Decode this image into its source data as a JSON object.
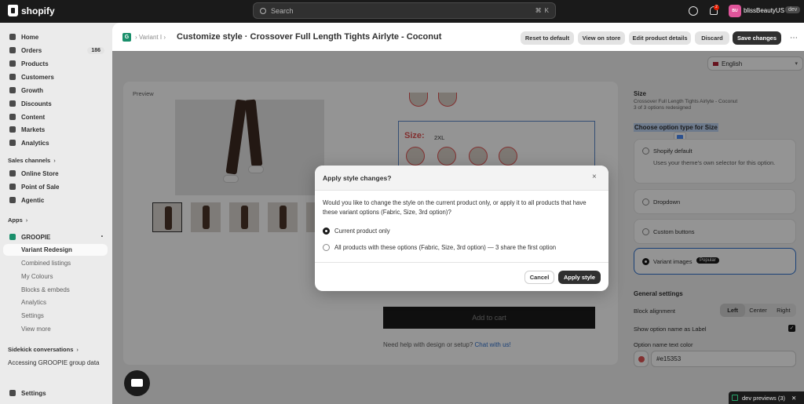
{
  "topbar": {
    "brand": "shopify",
    "search_placeholder": "Search",
    "shortcut_1": "⌘",
    "shortcut_2": "K",
    "notification_count": "2",
    "avatar_initials": "BU",
    "store_name": "blissBeautyUS",
    "dev_badge": "dev"
  },
  "sidebar": {
    "items": [
      {
        "label": "Home"
      },
      {
        "label": "Orders",
        "count": "186"
      },
      {
        "label": "Products"
      },
      {
        "label": "Customers"
      },
      {
        "label": "Growth"
      },
      {
        "label": "Discounts"
      },
      {
        "label": "Content"
      },
      {
        "label": "Markets"
      },
      {
        "label": "Analytics"
      }
    ],
    "sales_channels_label": "Sales channels",
    "channels": [
      {
        "label": "Online Store"
      },
      {
        "label": "Point of Sale"
      },
      {
        "label": "Agentic"
      }
    ],
    "apps_label": "Apps",
    "app_name": "GROOPIE",
    "app_subitems": [
      {
        "label": "Variant Redesign"
      },
      {
        "label": "Combined listings"
      },
      {
        "label": "My Colours"
      },
      {
        "label": "Blocks & embeds"
      },
      {
        "label": "Analytics"
      },
      {
        "label": "Settings"
      },
      {
        "label": "View more"
      }
    ],
    "sidekick_label": "Sidekick conversations",
    "sidekick_chat": "Accessing GROOPIE group data",
    "settings_label": "Settings"
  },
  "header": {
    "breadcrumb": "Variant I",
    "title": "Customize style · Crossover Full Length Tights Airlyte - Coconut",
    "buttons": {
      "reset": "Reset to default",
      "view_store": "View on store",
      "edit_product": "Edit product details",
      "discard": "Discard",
      "save": "Save changes"
    }
  },
  "language": "English",
  "preview": {
    "label": "Preview",
    "size_label": "Size:",
    "size_value": "2XL",
    "add_to_cart": "Add to cart",
    "help_text": "Need help with design or setup?",
    "help_link": "Chat with us!"
  },
  "settings": {
    "title": "Size",
    "product": "Crossover Full Length Tights Airlyte - Coconut",
    "redesigned": "3 of 3 options redesigned",
    "choose_label": "Choose option type for Size",
    "options": [
      {
        "label": "Shopify default",
        "desc": "Uses your theme's own selector for this option."
      },
      {
        "label": "Dropdown"
      },
      {
        "label": "Custom buttons"
      },
      {
        "label": "Variant images",
        "badge": "Popular"
      }
    ],
    "general_title": "General settings",
    "block_alignment_label": "Block alignment",
    "alignment": [
      "Left",
      "Center",
      "Right"
    ],
    "selected_alignment": "Left",
    "show_option_label": "Show option name as Label",
    "text_color_label": "Option name text color",
    "text_color": "#e15353"
  },
  "modal": {
    "title": "Apply style changes?",
    "body": "Would you like to change the style on the current product only, or apply it to all products that have these variant options (Fabric, Size, 3rd option)?",
    "option_current": "Current product only",
    "option_all": "All products with these options (Fabric, Size, 3rd option) — 3 share the first option",
    "cancel": "Cancel",
    "apply": "Apply style"
  },
  "devbar": {
    "label": "dev previews",
    "count": "(3)"
  },
  "colors": {
    "accent": "#303030",
    "size_red": "#e15353",
    "selected_border": "#2c6ecb"
  }
}
